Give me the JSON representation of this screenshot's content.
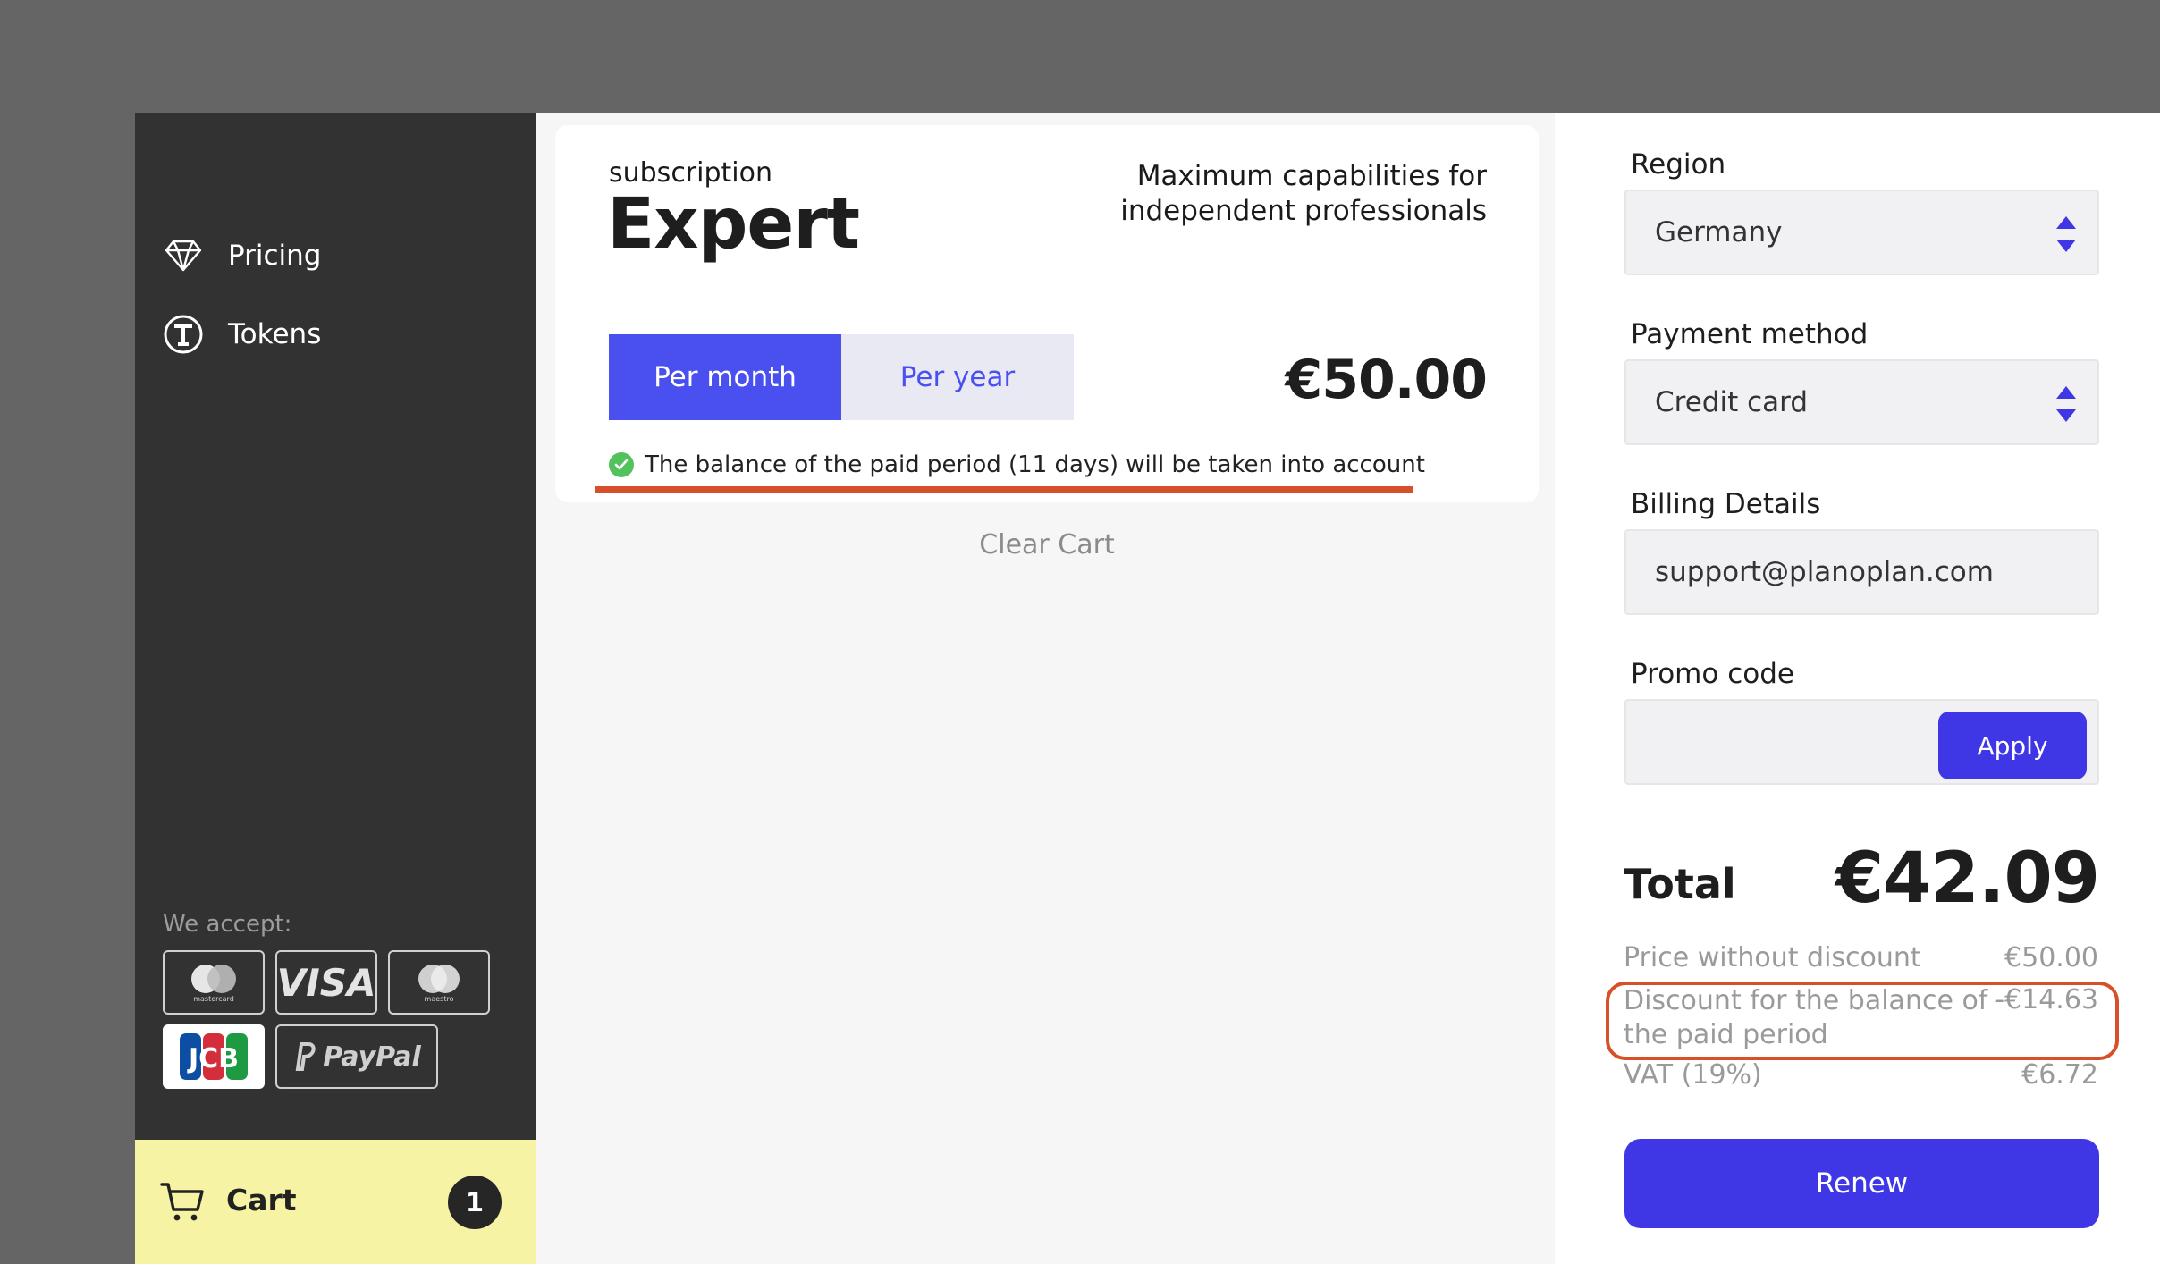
{
  "nav": {
    "pricing": "Pricing",
    "tokens": "Tokens"
  },
  "payments": {
    "label": "We accept:",
    "mastercard": "mastercard",
    "visa": "VISA",
    "maestro": "maestro",
    "jcb": "JCB",
    "paypal": "PayPal"
  },
  "cart": {
    "label": "Cart",
    "count": "1"
  },
  "product": {
    "subtitle": "subscription",
    "name": "Expert",
    "description": "Maximum capabilities for independent professionals",
    "toggle_month": "Per month",
    "toggle_year": "Per year",
    "selected_period": "Per month",
    "price": "€50.00",
    "balance_note": "The balance of the paid period (11 days) will be taken into account"
  },
  "clear_cart": "Clear Cart",
  "checkout": {
    "region_label": "Region",
    "region_value": "Germany",
    "payment_label": "Payment method",
    "payment_value": "Credit card",
    "billing_label": "Billing Details",
    "billing_value": "support@planoplan.com",
    "promo_label": "Promo code",
    "promo_value": "",
    "apply": "Apply",
    "total_label": "Total",
    "total_value": "€42.09",
    "price_without_discount_label": "Price without discount",
    "price_without_discount_value": "€50.00",
    "discount_label": "Discount for the balance of the paid period",
    "discount_value": "-€14.63",
    "vat_label": "VAT (19%)",
    "vat_value": "€6.72",
    "renew": "Renew"
  },
  "colors": {
    "accent": "#3f37e6",
    "toggle_active": "#4a50f0",
    "annotation": "#d6512a",
    "cart_bg": "#f7f3a4",
    "sidebar_bg": "#323232"
  }
}
